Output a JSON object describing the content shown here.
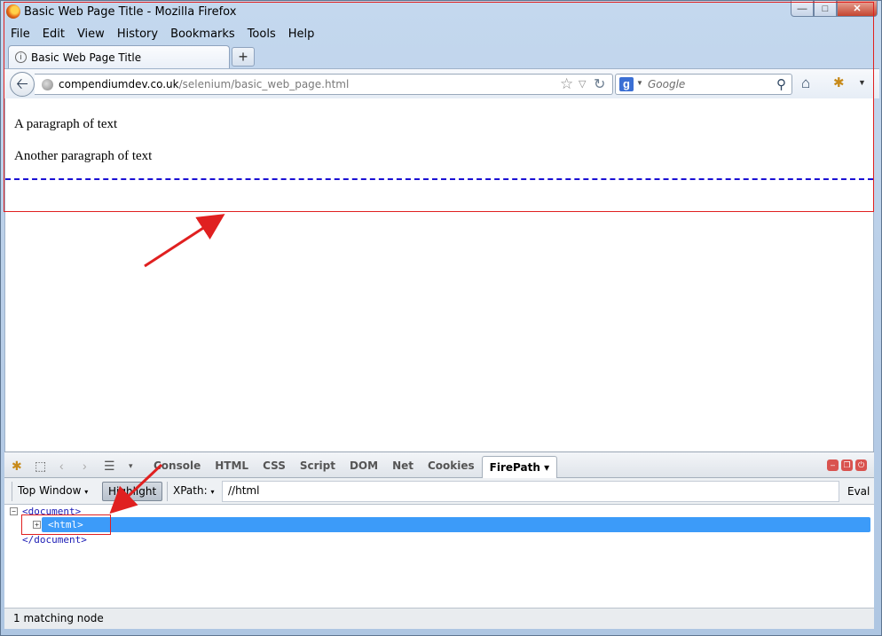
{
  "window": {
    "title": "Basic Web Page Title - Mozilla Firefox",
    "minimize": "—",
    "maximize": "□",
    "close": "✕"
  },
  "menu": [
    "File",
    "Edit",
    "View",
    "History",
    "Bookmarks",
    "Tools",
    "Help"
  ],
  "tab": {
    "label": "Basic Web Page Title",
    "icon": "info-icon"
  },
  "new_tab": "+",
  "nav": {
    "url_host": "compendiumdev.co.uk",
    "url_path": "/selenium/basic_web_page.html",
    "search_placeholder": "Google"
  },
  "page": {
    "paragraphs": [
      "A paragraph of text",
      "Another paragraph of text"
    ]
  },
  "firebug": {
    "tabs": [
      "Console",
      "HTML",
      "CSS",
      "Script",
      "DOM",
      "Net",
      "Cookies",
      "FirePath ▾"
    ],
    "active_tab": "FirePath"
  },
  "firepath": {
    "top_window": "Top Window",
    "highlight": "Highlight",
    "xpath_label": "XPath:",
    "xpath_value": "//html",
    "eval": "Eval"
  },
  "tree": {
    "document_open": "<document>",
    "html_node": "<html>",
    "document_close": "</document>"
  },
  "status": "1 matching node",
  "colors": {
    "annotation": "#e02020",
    "selection": "#3c9bf9",
    "dashed_border": "#1a10d4"
  }
}
